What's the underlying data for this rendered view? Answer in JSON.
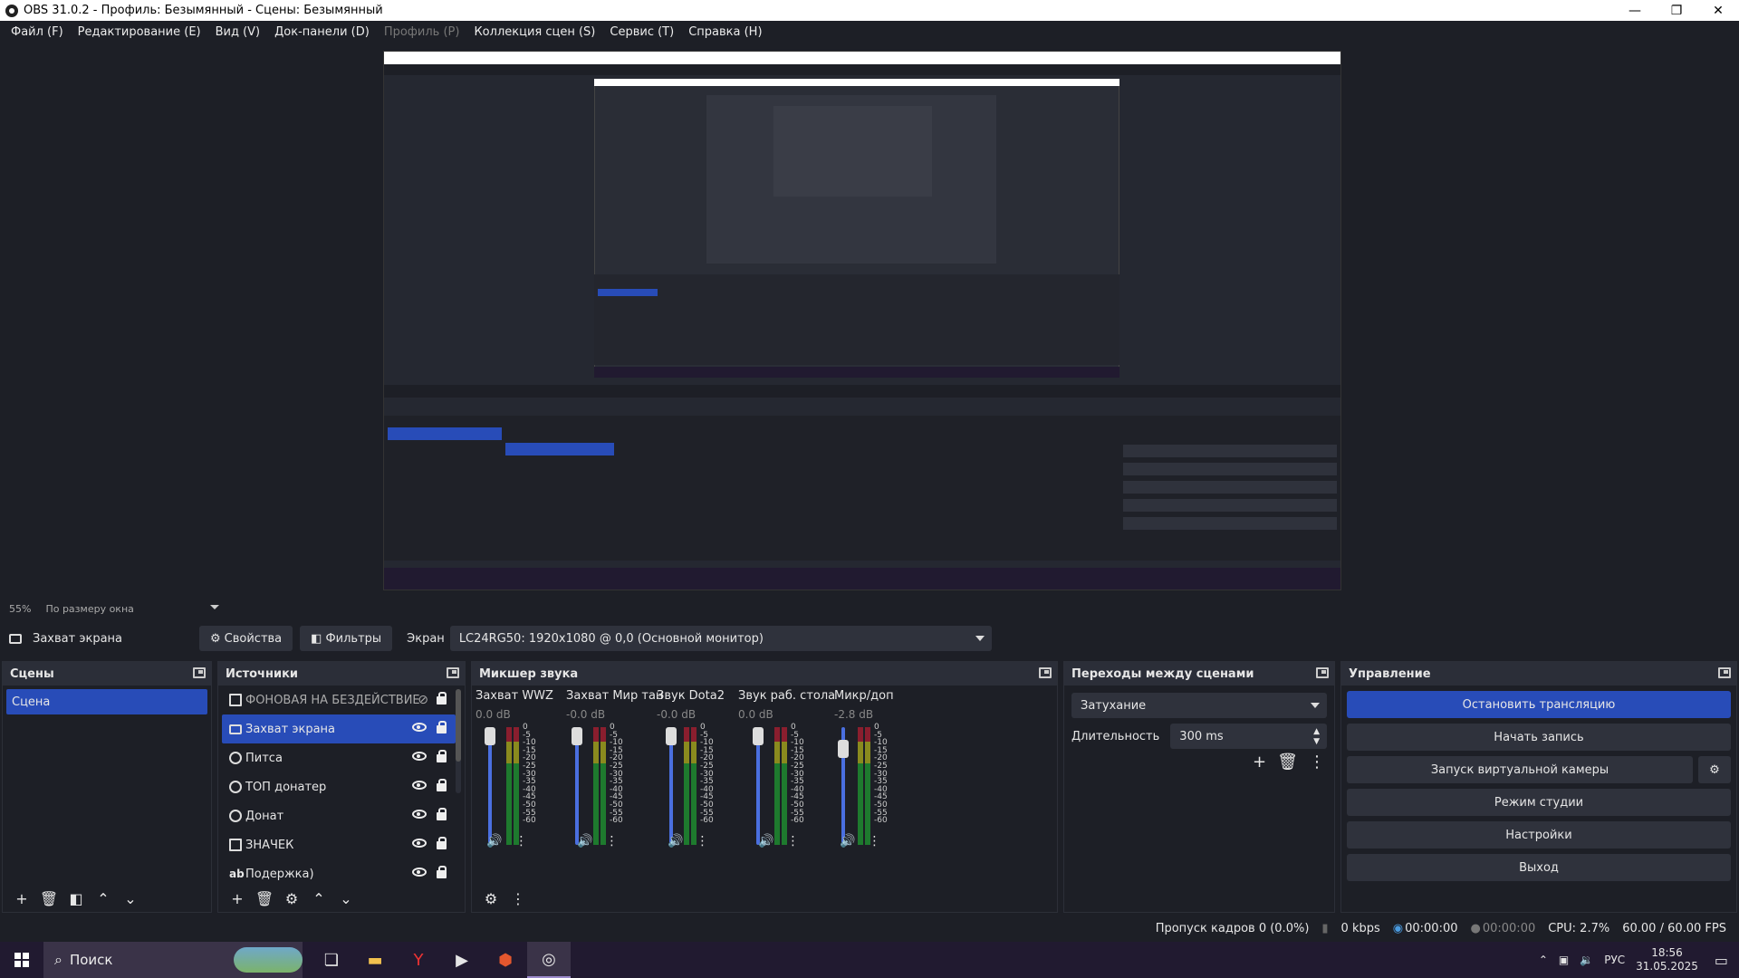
{
  "window": {
    "title": "OBS 31.0.2 - Профиль: Безымянный - Сцены: Безымянный",
    "controls": [
      "—",
      "❐",
      "✕"
    ]
  },
  "menu": [
    {
      "label": "Файл (F)",
      "disabled": false
    },
    {
      "label": "Редактирование (E)",
      "disabled": false
    },
    {
      "label": "Вид (V)",
      "disabled": false
    },
    {
      "label": "Док-панели (D)",
      "disabled": false
    },
    {
      "label": "Профиль (P)",
      "disabled": true
    },
    {
      "label": "Коллекция сцен (S)",
      "disabled": false
    },
    {
      "label": "Сервис (T)",
      "disabled": false
    },
    {
      "label": "Справка (H)",
      "disabled": false
    }
  ],
  "preview": {
    "zoom": "55%",
    "scale_mode": "По размеру окна"
  },
  "source_toolbar": {
    "source_name": "Захват экрана",
    "properties_label": "Свойства",
    "filters_label": "Фильтры",
    "screen_label": "Экран",
    "screen_value": "LC24RG50: 1920x1080 @ 0,0 (Основной монитор)"
  },
  "scenes": {
    "title": "Сцены",
    "items": [
      {
        "label": "Сцена",
        "selected": true
      }
    ]
  },
  "sources": {
    "title": "Источники",
    "items": [
      {
        "label": "ФОНОВАЯ НА БЕЗДЕЙСТВИЕ",
        "icon": "image-icon",
        "visible": false,
        "selected": false
      },
      {
        "label": "Захват экрана",
        "icon": "monitor-icon",
        "visible": true,
        "selected": true
      },
      {
        "label": "Питса",
        "icon": "browser-icon",
        "visible": true,
        "selected": false
      },
      {
        "label": "ТОП донатер",
        "icon": "browser-icon",
        "visible": true,
        "selected": false
      },
      {
        "label": "Донат",
        "icon": "browser-icon",
        "visible": true,
        "selected": false
      },
      {
        "label": "ЗНАЧЕК",
        "icon": "image-icon",
        "visible": true,
        "selected": false
      },
      {
        "label": "Подержка)",
        "icon": "text-icon",
        "visible": true,
        "selected": false
      }
    ]
  },
  "mixer": {
    "title": "Микшер звука",
    "channels": [
      {
        "name": "Захват WWZ",
        "db": "0.0 dB",
        "level": 1.0
      },
      {
        "name": "Захват Мир тан",
        "db": "-0.0 dB",
        "level": 1.0
      },
      {
        "name": "Звук Dota2",
        "db": "-0.0 dB",
        "level": 1.0
      },
      {
        "name": "Звук раб. стола",
        "db": "0.0 dB",
        "level": 1.0
      },
      {
        "name": "Микр/доп",
        "db": "-2.8 dB",
        "level": 0.88
      }
    ],
    "scale": [
      "0",
      "-5",
      "-10",
      "-15",
      "-20",
      "-25",
      "-30",
      "-35",
      "-40",
      "-45",
      "-50",
      "-55",
      "-60"
    ]
  },
  "transitions": {
    "title": "Переходы между сценами",
    "type": "Затухание",
    "duration_label": "Длительность",
    "duration_value": "300 ms"
  },
  "controls": {
    "title": "Управление",
    "buttons": [
      {
        "label": "Остановить трансляцию",
        "primary": true
      },
      {
        "label": "Начать запись",
        "primary": false
      },
      {
        "label": "Запуск виртуальной камеры",
        "primary": false
      },
      {
        "label": "Режим студии",
        "primary": false
      },
      {
        "label": "Настройки",
        "primary": false
      },
      {
        "label": "Выход",
        "primary": false
      }
    ]
  },
  "status": {
    "dropped_frames": "Пропуск кадров 0 (0.0%)",
    "bitrate": "0 kbps",
    "stream_time": "00:00:00",
    "record_time": "00:00:00",
    "cpu": "CPU: 2.7%",
    "fps": "60.00 / 60.00 FPS"
  },
  "taskbar": {
    "search_placeholder": "Поиск",
    "lang": "РУС",
    "time": "18:56",
    "date": "31.05.2025"
  },
  "colors": {
    "accent": "#284cb8",
    "panel_bg": "#1d1f26",
    "header_bg": "#2b2e38",
    "button_bg": "#2f323c"
  }
}
